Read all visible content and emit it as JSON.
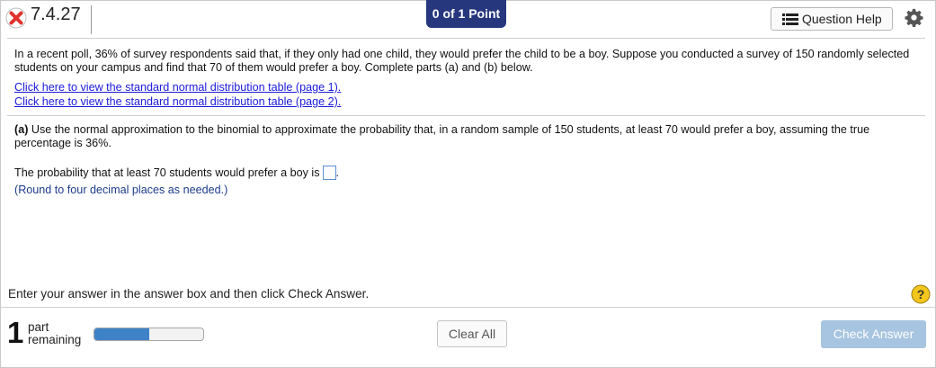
{
  "header": {
    "question_number": "7.4.27",
    "score": "0 of 1 Point",
    "question_help_label": "Question Help"
  },
  "content": {
    "intro": "In a recent poll, 36% of survey respondents said that, if they only had one child, they would prefer the child to be a boy. Suppose you conducted a survey of 150 randomly selected students on your campus and find that 70 of them would prefer a boy. Complete parts (a) and (b) below.",
    "link_page1": "Click here to view the standard normal distribution table (page 1).",
    "link_page2": "Click here to view the standard normal distribution table (page 2).",
    "part_a_label": "(a)",
    "part_a_text": " Use the normal approximation to the binomial to approximate the probability that, in a random sample of 150 students, at least 70 would prefer a boy, assuming the true percentage is 36%.",
    "answer_prompt": "The probability that at least 70 students would prefer a boy is",
    "answer_value": "",
    "answer_suffix": ".",
    "round_note": "(Round to four decimal places as needed.)"
  },
  "instruction": "Enter your answer in the answer box and then click Check Answer.",
  "footer": {
    "parts_remaining_count": "1",
    "part_word": "part",
    "remaining_word": "remaining",
    "progress_fraction": 0.5,
    "clear_all_label": "Clear All",
    "check_answer_label": "Check Answer"
  },
  "colors": {
    "score_badge": "#26377d",
    "link": "#1a1adb",
    "progress_fill": "#3e82c8",
    "check_button_disabled": "#a7c4e0",
    "incorrect_icon": "#e2312c",
    "help_icon": "#f3c61b"
  },
  "icons": {
    "status": "x-circle-icon",
    "question_help": "list-icon",
    "settings": "gear-icon",
    "help": "question-circle-icon"
  }
}
